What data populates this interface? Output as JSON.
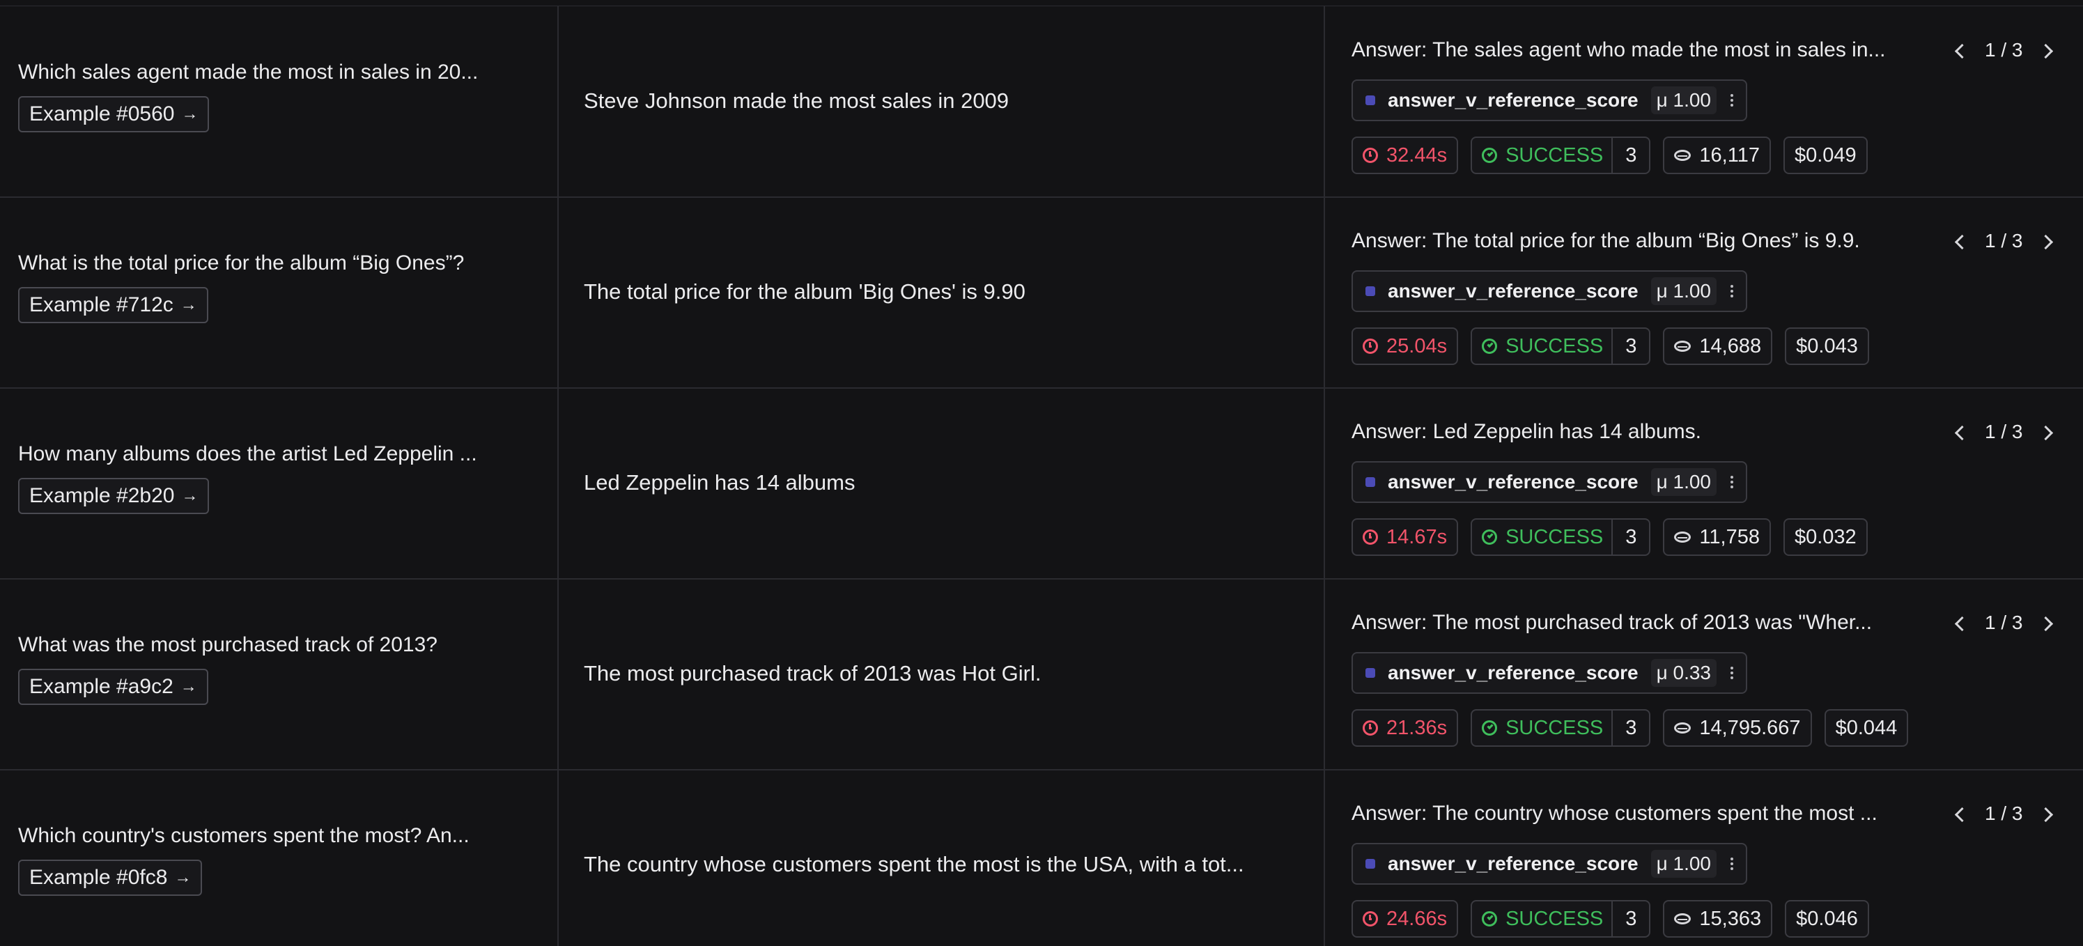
{
  "rows": [
    {
      "question": "Which sales agent made the most in sales in 20...",
      "example": "Example #0560",
      "output": "Steve Johnson made the most sales in 2009",
      "answer": "Answer: The sales agent who made the most in sales in...",
      "pager": "1 / 3",
      "score_name": "answer_v_reference_score",
      "score_value": "μ 1.00",
      "latency": "32.44s",
      "status": "SUCCESS",
      "status_count": "3",
      "tokens": "16,117",
      "cost": "$0.049"
    },
    {
      "question": "What is the total price for the album “Big Ones”?",
      "example": "Example #712c",
      "output": "The total price for the album 'Big Ones' is 9.90",
      "answer": "Answer: The total price for the album “Big Ones” is 9.9.",
      "pager": "1 / 3",
      "score_name": "answer_v_reference_score",
      "score_value": "μ 1.00",
      "latency": "25.04s",
      "status": "SUCCESS",
      "status_count": "3",
      "tokens": "14,688",
      "cost": "$0.043"
    },
    {
      "question": "How many albums does the artist Led Zeppelin ...",
      "example": "Example #2b20",
      "output": "Led Zeppelin has 14 albums",
      "answer": "Answer: Led Zeppelin has 14 albums.",
      "pager": "1 / 3",
      "score_name": "answer_v_reference_score",
      "score_value": "μ 1.00",
      "latency": "14.67s",
      "status": "SUCCESS",
      "status_count": "3",
      "tokens": "11,758",
      "cost": "$0.032"
    },
    {
      "question": "What was the most purchased track of 2013?",
      "example": "Example #a9c2",
      "output": "The most purchased track of 2013 was Hot Girl.",
      "answer": "Answer: The most purchased track of 2013 was \"Wher...",
      "pager": "1 / 3",
      "score_name": "answer_v_reference_score",
      "score_value": "μ 0.33",
      "latency": "21.36s",
      "status": "SUCCESS",
      "status_count": "3",
      "tokens": "14,795.667",
      "cost": "$0.044"
    },
    {
      "question": "Which country's customers spent the most? An...",
      "example": "Example #0fc8",
      "output": "The country whose customers spent the most is the USA, with a tot...",
      "answer": "Answer: The country whose customers spent the most ...",
      "pager": "1 / 3",
      "score_name": "answer_v_reference_score",
      "score_value": "μ 1.00",
      "latency": "24.66s",
      "status": "SUCCESS",
      "status_count": "3",
      "tokens": "15,363",
      "cost": "$0.046"
    }
  ]
}
